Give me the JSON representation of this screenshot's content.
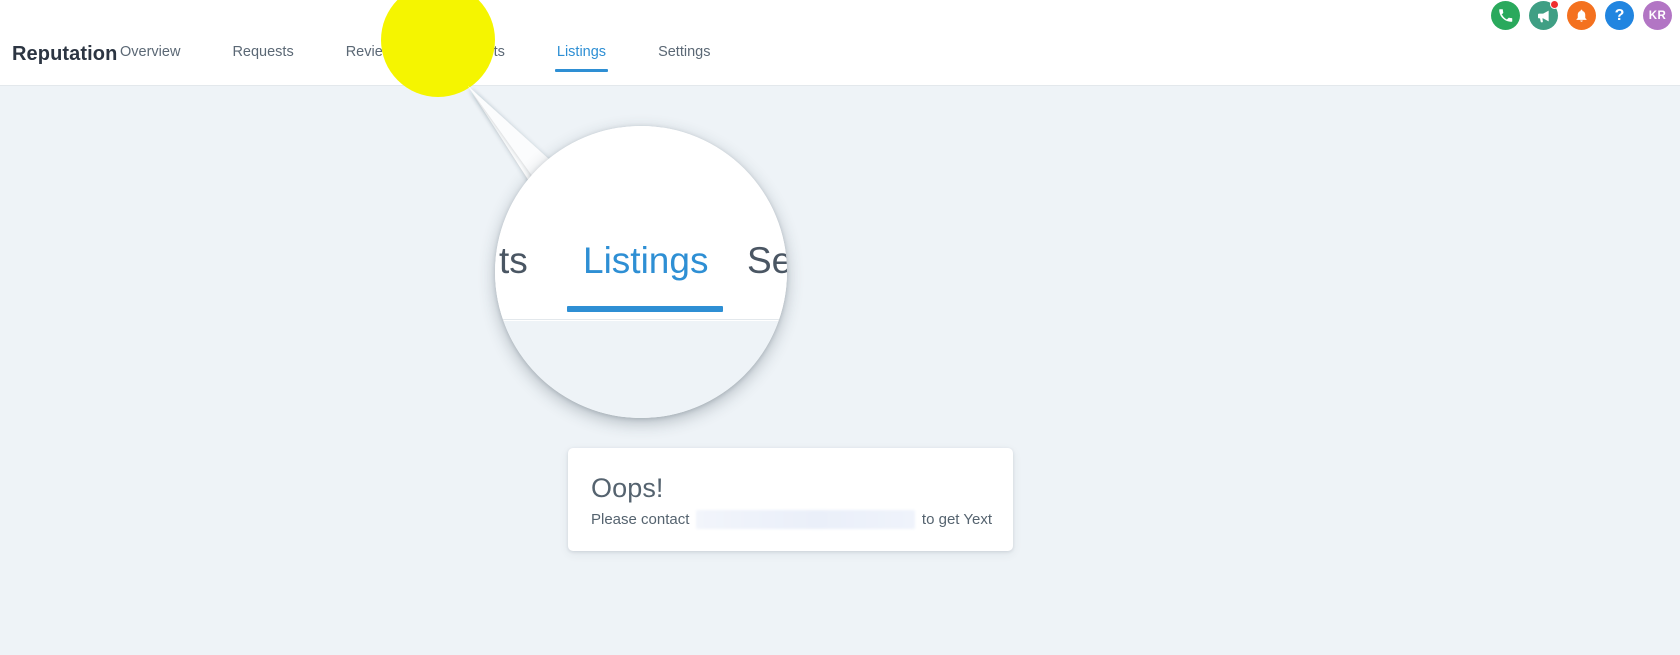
{
  "header": {
    "brand": "Reputation",
    "nav": [
      {
        "label": "Overview",
        "active": false
      },
      {
        "label": "Requests",
        "active": false
      },
      {
        "label": "Reviews",
        "active": false
      },
      {
        "label": "Widgets",
        "active": false
      },
      {
        "label": "Listings",
        "active": true
      },
      {
        "label": "Settings",
        "active": false
      }
    ],
    "icons": [
      {
        "name": "phone-icon",
        "label": "",
        "color": "#2aa95c",
        "badge": false
      },
      {
        "name": "megaphone-icon",
        "label": "",
        "color": "#3f9f84",
        "badge": true
      },
      {
        "name": "bell-icon",
        "label": "",
        "color": "#f4711f",
        "badge": false
      },
      {
        "name": "help-icon",
        "label": "?",
        "color": "#2185e0",
        "badge": false
      },
      {
        "name": "user-avatar",
        "label": "KR",
        "color": "#b275c4",
        "badge": false
      }
    ]
  },
  "magnifier": {
    "prev_text": "ts",
    "active_text": "Listings",
    "next_text": "Se",
    "active_color": "#2e8fd4"
  },
  "highlight": {
    "color": "#f5f500",
    "target": "Listings"
  },
  "card": {
    "title": "Oops!",
    "message_before": "Please contact",
    "message_redacted": "",
    "message_after": "to get Yext"
  },
  "colors": {
    "page_background": "#eef3f7",
    "surface": "#ffffff",
    "accent": "#2e8fd4",
    "text_primary": "#2c3542",
    "text_secondary": "#5b6875",
    "highlight": "#f5f500"
  }
}
